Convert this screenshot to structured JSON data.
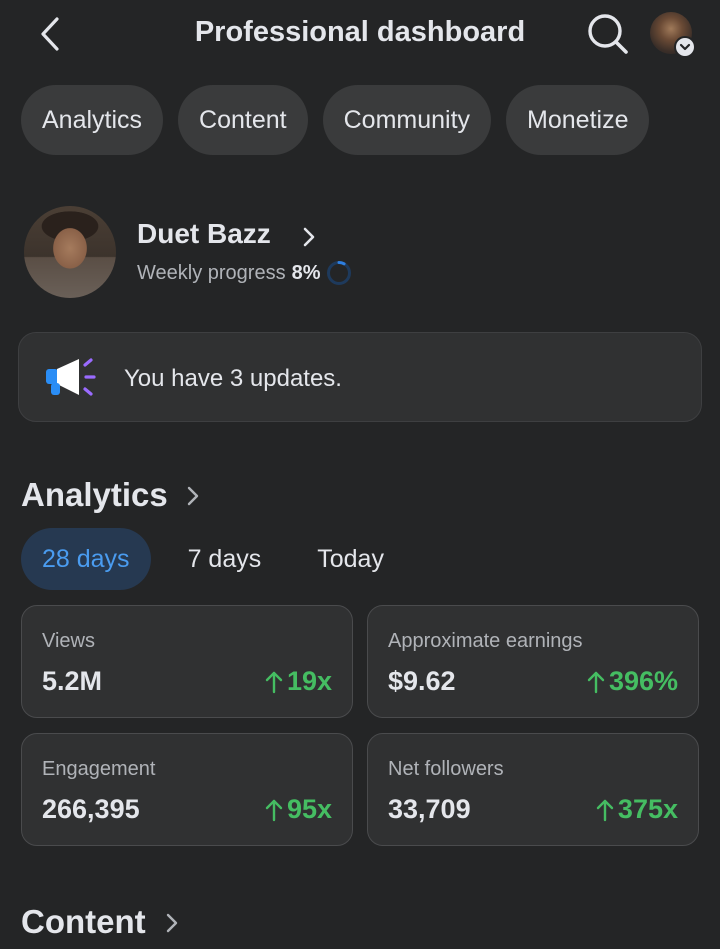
{
  "header": {
    "title": "Professional dashboard"
  },
  "tabs": [
    {
      "label": "Analytics"
    },
    {
      "label": "Content"
    },
    {
      "label": "Community"
    },
    {
      "label": "Monetize"
    }
  ],
  "profile": {
    "name": "Duet Bazz",
    "progress_label": "Weekly progress",
    "progress_value": "8%",
    "progress_fraction": 0.08
  },
  "updates": {
    "text": "You have 3 updates."
  },
  "analytics": {
    "title": "Analytics",
    "ranges": [
      {
        "label": "28 days",
        "selected": true
      },
      {
        "label": "7 days",
        "selected": false
      },
      {
        "label": "Today",
        "selected": false
      }
    ],
    "metrics": [
      {
        "label": "Views",
        "value": "5.2M",
        "delta": "19x"
      },
      {
        "label": "Approximate earnings",
        "value": "$9.62",
        "delta": "396%"
      },
      {
        "label": "Engagement",
        "value": "266,395",
        "delta": "95x"
      },
      {
        "label": "Net followers",
        "value": "33,709",
        "delta": "375x"
      }
    ]
  },
  "content_section": {
    "title": "Content"
  },
  "colors": {
    "background": "#242526",
    "chip": "#3a3b3c",
    "accent_blue": "#4a9cf0",
    "positive_green": "#45bd62",
    "megaphone_purple": "#9a6bff"
  }
}
